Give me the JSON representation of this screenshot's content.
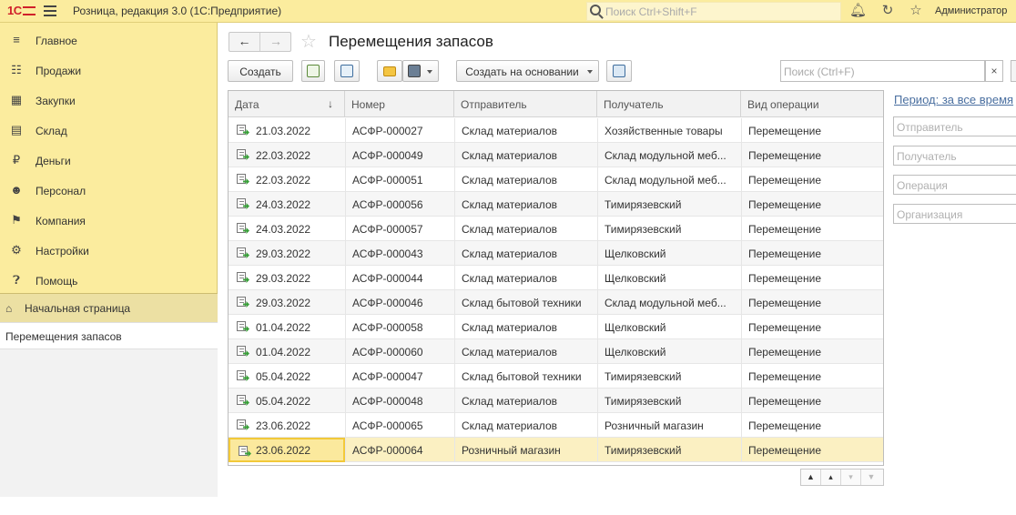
{
  "topbar": {
    "logo": "1С",
    "app_title": "Розница, редакция 3.0  (1С:Предприятие)",
    "search_placeholder": "Поиск Ctrl+Shift+F",
    "user": "Администратор"
  },
  "sidebar": {
    "items": [
      {
        "label": "Главное",
        "icon": "menu-lines-icon"
      },
      {
        "label": "Продажи",
        "icon": "basket-icon"
      },
      {
        "label": "Закупки",
        "icon": "purchases-icon"
      },
      {
        "label": "Склад",
        "icon": "warehouse-icon"
      },
      {
        "label": "Деньги",
        "icon": "ruble-icon"
      },
      {
        "label": "Персонал",
        "icon": "people-icon"
      },
      {
        "label": "Компания",
        "icon": "flag-icon"
      },
      {
        "label": "Настройки",
        "icon": "gear-icon"
      },
      {
        "label": "Помощь",
        "icon": "help-icon"
      }
    ],
    "home_page": "Начальная страница",
    "current_page": "Перемещения запасов"
  },
  "page": {
    "title": "Перемещения запасов"
  },
  "toolbar": {
    "create_label": "Создать",
    "create_based_label": "Создать на основании",
    "search_placeholder": "Поиск (Ctrl+F)",
    "clear_label": "×"
  },
  "table": {
    "headers": [
      "Дата",
      "Номер",
      "Отправитель",
      "Получатель",
      "Вид операции"
    ],
    "sort_indicator": "↓",
    "rows": [
      {
        "date": "21.03.2022",
        "number": "АСФР-000027",
        "sender": "Склад материалов",
        "receiver": "Хозяйственные товары",
        "operation": "Перемещение"
      },
      {
        "date": "22.03.2022",
        "number": "АСФР-000049",
        "sender": "Склад материалов",
        "receiver": "Склад модульной меб...",
        "operation": "Перемещение"
      },
      {
        "date": "22.03.2022",
        "number": "АСФР-000051",
        "sender": "Склад материалов",
        "receiver": "Склад модульной меб...",
        "operation": "Перемещение"
      },
      {
        "date": "24.03.2022",
        "number": "АСФР-000056",
        "sender": "Склад материалов",
        "receiver": "Тимирязевский",
        "operation": "Перемещение"
      },
      {
        "date": "24.03.2022",
        "number": "АСФР-000057",
        "sender": "Склад материалов",
        "receiver": "Тимирязевский",
        "operation": "Перемещение"
      },
      {
        "date": "29.03.2022",
        "number": "АСФР-000043",
        "sender": "Склад материалов",
        "receiver": "Щелковский",
        "operation": "Перемещение"
      },
      {
        "date": "29.03.2022",
        "number": "АСФР-000044",
        "sender": "Склад материалов",
        "receiver": "Щелковский",
        "operation": "Перемещение"
      },
      {
        "date": "29.03.2022",
        "number": "АСФР-000046",
        "sender": "Склад бытовой техники",
        "receiver": "Склад модульной меб...",
        "operation": "Перемещение"
      },
      {
        "date": "01.04.2022",
        "number": "АСФР-000058",
        "sender": "Склад материалов",
        "receiver": "Щелковский",
        "operation": "Перемещение"
      },
      {
        "date": "01.04.2022",
        "number": "АСФР-000060",
        "sender": "Склад материалов",
        "receiver": "Щелковский",
        "operation": "Перемещение"
      },
      {
        "date": "05.04.2022",
        "number": "АСФР-000047",
        "sender": "Склад бытовой техники",
        "receiver": "Тимирязевский",
        "operation": "Перемещение"
      },
      {
        "date": "05.04.2022",
        "number": "АСФР-000048",
        "sender": "Склад материалов",
        "receiver": "Тимирязевский",
        "operation": "Перемещение"
      },
      {
        "date": "23.06.2022",
        "number": "АСФР-000065",
        "sender": "Склад материалов",
        "receiver": "Розничный магазин",
        "operation": "Перемещение"
      },
      {
        "date": "23.06.2022",
        "number": "АСФР-000064",
        "sender": "Розничный магазин",
        "receiver": "Тимирязевский",
        "operation": "Перемещение"
      }
    ],
    "selected_index": 13
  },
  "filters": {
    "period": "Период: за все время",
    "sender_placeholder": "Отправитель",
    "receiver_placeholder": "Получатель",
    "operation_placeholder": "Операция",
    "organization_placeholder": "Организация"
  },
  "colors": {
    "accent": "#fbec9e",
    "selection": "#fbe99d",
    "logo_red": "#d0202a",
    "link": "#4a6fa0"
  }
}
